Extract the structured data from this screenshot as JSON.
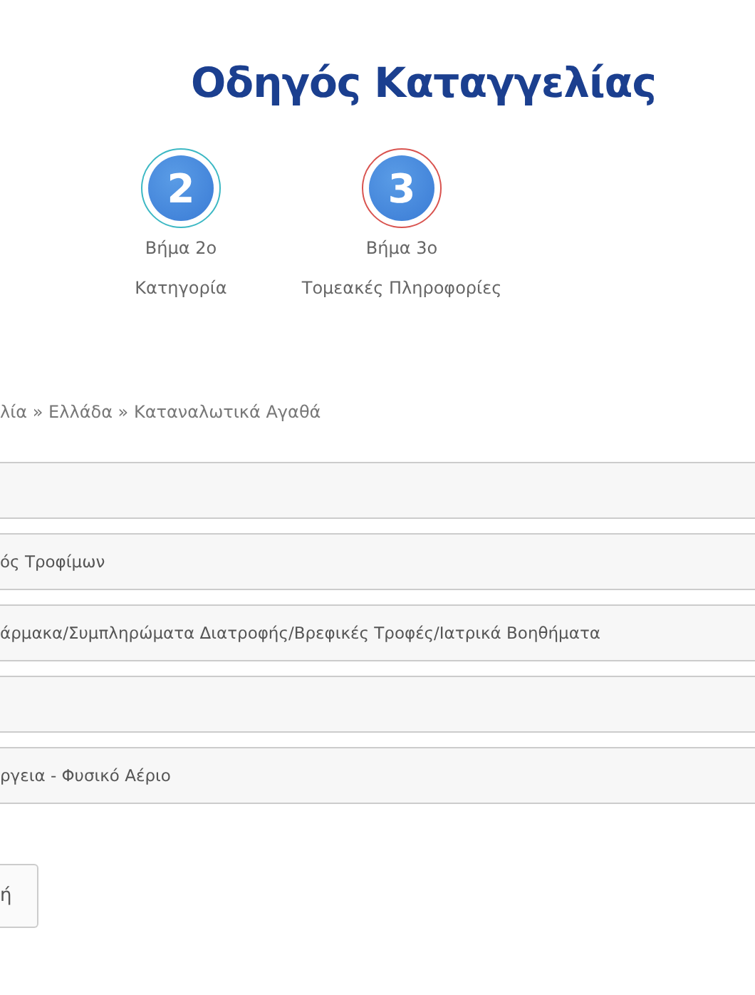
{
  "title": "Οδηγός Καταγγελίας",
  "steps": [
    {
      "number": "2",
      "label": "Βήμα 2ο",
      "caption": "Κατηγορία",
      "color": "#3cb8c4"
    },
    {
      "number": "3",
      "label": "Βήμα 3ο",
      "caption": "Τομεακές Πληροφορίες",
      "color": "#d9534f"
    }
  ],
  "breadcrumb": "λία » Ελλάδα » Καταναλωτικά Αγαθά",
  "fields": [
    {
      "kind": "empty"
    },
    {
      "kind": "filled",
      "value": "ός Τροφίμων"
    },
    {
      "kind": "filled",
      "value": "άρμακα/Συμπληρώματα Διατροφής/Βρεφικές Τροφές/Ιατρικά Βοηθήματα"
    },
    {
      "kind": "empty"
    },
    {
      "kind": "filled",
      "value": "ργεια - Φυσικό Αέριο"
    }
  ],
  "button": "ή"
}
